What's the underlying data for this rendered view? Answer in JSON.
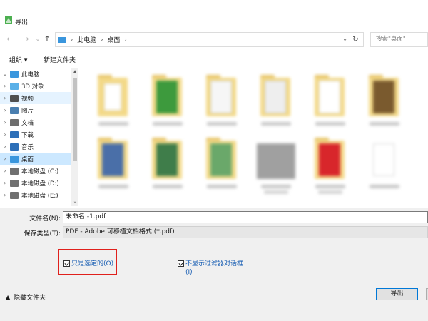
{
  "window": {
    "title": "导出"
  },
  "address": {
    "crumbs": [
      "此电脑",
      "桌面"
    ],
    "search_placeholder": "搜索\"桌面\""
  },
  "toolbar": {
    "organize": "组织 ▾",
    "new_folder": "新建文件夹"
  },
  "nav_tree": [
    {
      "label": "此电脑",
      "icon": "computer-icon",
      "expand": "⌄",
      "state": ""
    },
    {
      "label": "3D 对象",
      "icon": "3d-objects-icon",
      "expand": "›",
      "state": ""
    },
    {
      "label": "视频",
      "icon": "video-icon",
      "expand": "›",
      "state": "hover"
    },
    {
      "label": "图片",
      "icon": "pictures-icon",
      "expand": "›",
      "state": ""
    },
    {
      "label": "文档",
      "icon": "documents-icon",
      "expand": "›",
      "state": ""
    },
    {
      "label": "下载",
      "icon": "download-icon",
      "expand": "›",
      "state": ""
    },
    {
      "label": "音乐",
      "icon": "music-icon",
      "expand": "›",
      "state": ""
    },
    {
      "label": "桌面",
      "icon": "desktop-icon",
      "expand": "›",
      "state": "selected"
    },
    {
      "label": "本地磁盘 (C:)",
      "icon": "drive-icon",
      "expand": "›",
      "state": ""
    },
    {
      "label": "本地磁盘 (D:)",
      "icon": "drive-icon",
      "expand": "›",
      "state": ""
    },
    {
      "label": "本地磁盘 (E:)",
      "icon": "drive-icon",
      "expand": "›",
      "state": ""
    }
  ],
  "form": {
    "filename_label": "文件名(N):",
    "filename_value": "未命名 -1.pdf",
    "filetype_label": "保存类型(T):",
    "filetype_value": "PDF - Adobe 可移植文档格式 (*.pdf)",
    "only_selected": "只是选定的(O)",
    "no_filter_dialog_line1": "不显示过滤器对话框",
    "no_filter_dialog_line2": "(I)",
    "hide_folders": "隐藏文件夹",
    "export_button": "导出"
  },
  "colors": {
    "accent": "#0078d7",
    "highlight_box": "#e0201c",
    "selected_bg": "#cce8ff"
  }
}
